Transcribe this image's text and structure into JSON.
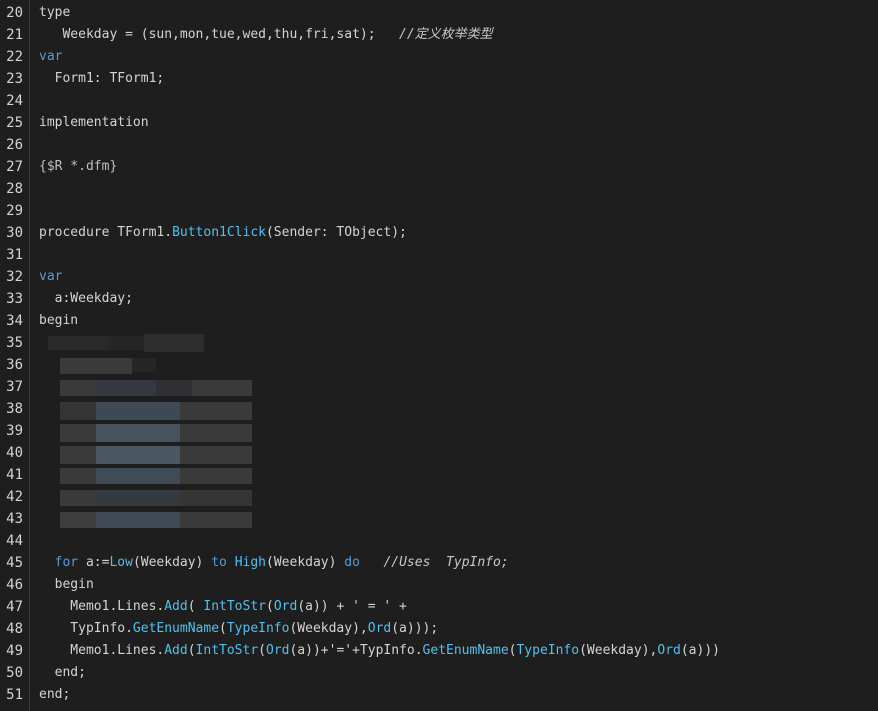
{
  "lines": [
    {
      "n": "20",
      "tokens": [
        {
          "t": "type",
          "c": ""
        }
      ]
    },
    {
      "n": "21",
      "tokens": [
        {
          "t": "   Weekday = (sun,mon,tue,wed,thu,fri,sat);   ",
          "c": ""
        },
        {
          "t": "//定义枚举类型",
          "c": "cm"
        }
      ]
    },
    {
      "n": "22",
      "tokens": [
        {
          "t": "var",
          "c": "blue"
        }
      ]
    },
    {
      "n": "23",
      "tokens": [
        {
          "t": "  Form1: TForm1;",
          "c": ""
        }
      ]
    },
    {
      "n": "24",
      "tokens": []
    },
    {
      "n": "25",
      "tokens": [
        {
          "t": "implementation",
          "c": ""
        }
      ]
    },
    {
      "n": "26",
      "tokens": []
    },
    {
      "n": "27",
      "tokens": [
        {
          "t": "{$R *.dfm}",
          "c": "dir"
        }
      ]
    },
    {
      "n": "28",
      "tokens": []
    },
    {
      "n": "29",
      "tokens": []
    },
    {
      "n": "30",
      "tokens": [
        {
          "t": "procedure TForm1.",
          "c": ""
        },
        {
          "t": "Button1Click",
          "c": "fn"
        },
        {
          "t": "(Sender: TObject);",
          "c": ""
        }
      ]
    },
    {
      "n": "31",
      "tokens": []
    },
    {
      "n": "32",
      "tokens": [
        {
          "t": "var",
          "c": "blue"
        }
      ]
    },
    {
      "n": "33",
      "tokens": [
        {
          "t": "  a:Weekday;",
          "c": ""
        }
      ]
    },
    {
      "n": "34",
      "tokens": [
        {
          "t": "begin",
          "c": ""
        }
      ]
    },
    {
      "n": "35",
      "tokens": []
    },
    {
      "n": "36",
      "tokens": []
    },
    {
      "n": "37",
      "tokens": []
    },
    {
      "n": "38",
      "tokens": []
    },
    {
      "n": "39",
      "tokens": []
    },
    {
      "n": "40",
      "tokens": []
    },
    {
      "n": "41",
      "tokens": []
    },
    {
      "n": "42",
      "tokens": []
    },
    {
      "n": "43",
      "tokens": []
    },
    {
      "n": "44",
      "tokens": []
    },
    {
      "n": "45",
      "tokens": [
        {
          "t": "  ",
          "c": ""
        },
        {
          "t": "for",
          "c": "blue"
        },
        {
          "t": " a:=",
          "c": ""
        },
        {
          "t": "Low",
          "c": "fn"
        },
        {
          "t": "(Weekday) ",
          "c": ""
        },
        {
          "t": "to",
          "c": "blue"
        },
        {
          "t": " ",
          "c": ""
        },
        {
          "t": "High",
          "c": "fn"
        },
        {
          "t": "(Weekday) ",
          "c": ""
        },
        {
          "t": "do",
          "c": "blue"
        },
        {
          "t": "   ",
          "c": ""
        },
        {
          "t": "//Uses  TypInfo;",
          "c": "cm"
        }
      ]
    },
    {
      "n": "46",
      "tokens": [
        {
          "t": "  begin",
          "c": ""
        }
      ]
    },
    {
      "n": "47",
      "tokens": [
        {
          "t": "    Memo1.Lines.",
          "c": ""
        },
        {
          "t": "Add",
          "c": "fn"
        },
        {
          "t": "( ",
          "c": ""
        },
        {
          "t": "IntToStr",
          "c": "fn"
        },
        {
          "t": "(",
          "c": ""
        },
        {
          "t": "Ord",
          "c": "fn"
        },
        {
          "t": "(a)) + ' = ' +",
          "c": ""
        }
      ]
    },
    {
      "n": "48",
      "tokens": [
        {
          "t": "    TypInfo.",
          "c": ""
        },
        {
          "t": "GetEnumName",
          "c": "fn"
        },
        {
          "t": "(",
          "c": ""
        },
        {
          "t": "TypeInfo",
          "c": "fn"
        },
        {
          "t": "(Weekday),",
          "c": ""
        },
        {
          "t": "Ord",
          "c": "fn"
        },
        {
          "t": "(a)));",
          "c": ""
        }
      ]
    },
    {
      "n": "49",
      "tokens": [
        {
          "t": "    Memo1.Lines.",
          "c": ""
        },
        {
          "t": "Add",
          "c": "fn"
        },
        {
          "t": "(",
          "c": ""
        },
        {
          "t": "IntToStr",
          "c": "fn"
        },
        {
          "t": "(",
          "c": ""
        },
        {
          "t": "Ord",
          "c": "fn"
        },
        {
          "t": "(a))+'='+TypInfo.",
          "c": ""
        },
        {
          "t": "GetEnumName",
          "c": "fn"
        },
        {
          "t": "(",
          "c": ""
        },
        {
          "t": "TypeInfo",
          "c": "fn"
        },
        {
          "t": "(Weekday),",
          "c": ""
        },
        {
          "t": "Ord",
          "c": "fn"
        },
        {
          "t": "(a)))",
          "c": ""
        }
      ]
    },
    {
      "n": "50",
      "tokens": [
        {
          "t": "  end;",
          "c": ""
        }
      ]
    },
    {
      "n": "51",
      "tokens": [
        {
          "t": "end;",
          "c": ""
        }
      ]
    }
  ]
}
